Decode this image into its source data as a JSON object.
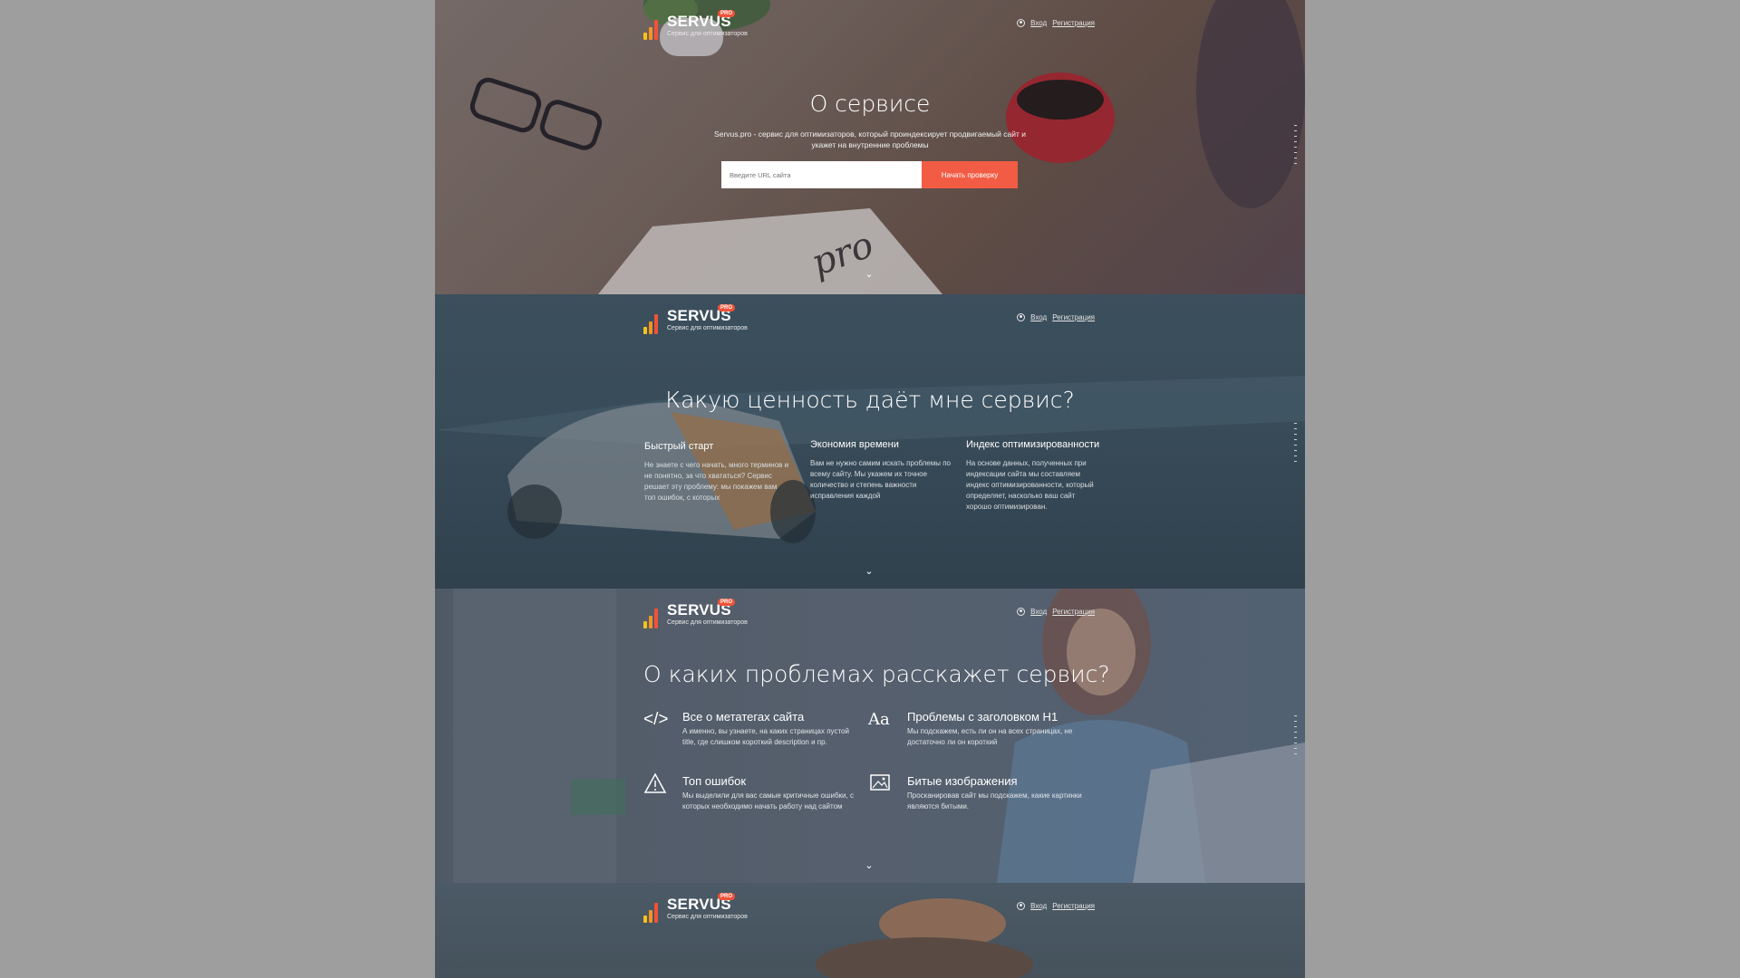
{
  "header": {
    "logo_name": "SERVUS",
    "logo_badge": "PRO",
    "logo_tagline": "Сервис для оптимизаторов",
    "login": "Вход",
    "register": "Регистрация",
    "colors": {
      "bar1": "#f7c21c",
      "bar2": "#f59422",
      "bar3": "#f0533a",
      "accent": "#f25c45"
    }
  },
  "hero": {
    "title": "О сервисе",
    "description": "Servus.pro - сервис для оптимизаторов, который проиндексирует продвигаемый сайт и укажет на внутренние проблемы",
    "url_placeholder": "Введите URL сайта",
    "button": "Начать проверку",
    "notebook_text": "pro"
  },
  "value": {
    "title": "Какую ценность даёт мне сервис?",
    "columns": [
      {
        "title": "Быстрый старт",
        "text": "Не знаете с чего начать, много терминов и не понятно, за что хвататься? Сервис решает эту проблему: мы покажем вам топ ошибок, с которых"
      },
      {
        "title": "Экономия времени",
        "text": "Вам не нужно самим искать проблемы по всему сайту. Мы укажем их точное количество и степень важности исправления каждой"
      },
      {
        "title": "Индекс оптимизированности",
        "text": "На основе данных, полученных при индексации сайта мы составляем индекс оптимизированности, который определяет, насколько ваш сайт хорошо оптимизирован."
      }
    ]
  },
  "problems": {
    "title": "О каких проблемах расскажет сервис?",
    "items": [
      {
        "icon": "code-icon",
        "title": "Все о метатегах сайта",
        "text": "А именно, вы узнаете, на каких страницах пустой title, где слишком короткий description и пр."
      },
      {
        "icon": "font-icon",
        "title": "Проблемы с заголовком H1",
        "text": "Мы подскажем, есть ли он на всех страницах, не достаточно ли он короткий"
      },
      {
        "icon": "warning-icon",
        "title": "Топ ошибок",
        "text": "Мы выделили для вас самые критичные ошибки, с которых необходимо начать работу над сайтом"
      },
      {
        "icon": "image-icon",
        "title": "Битые изображения",
        "text": "Просканировав сайт мы подскажем, какие картинки являются битыми."
      }
    ]
  }
}
